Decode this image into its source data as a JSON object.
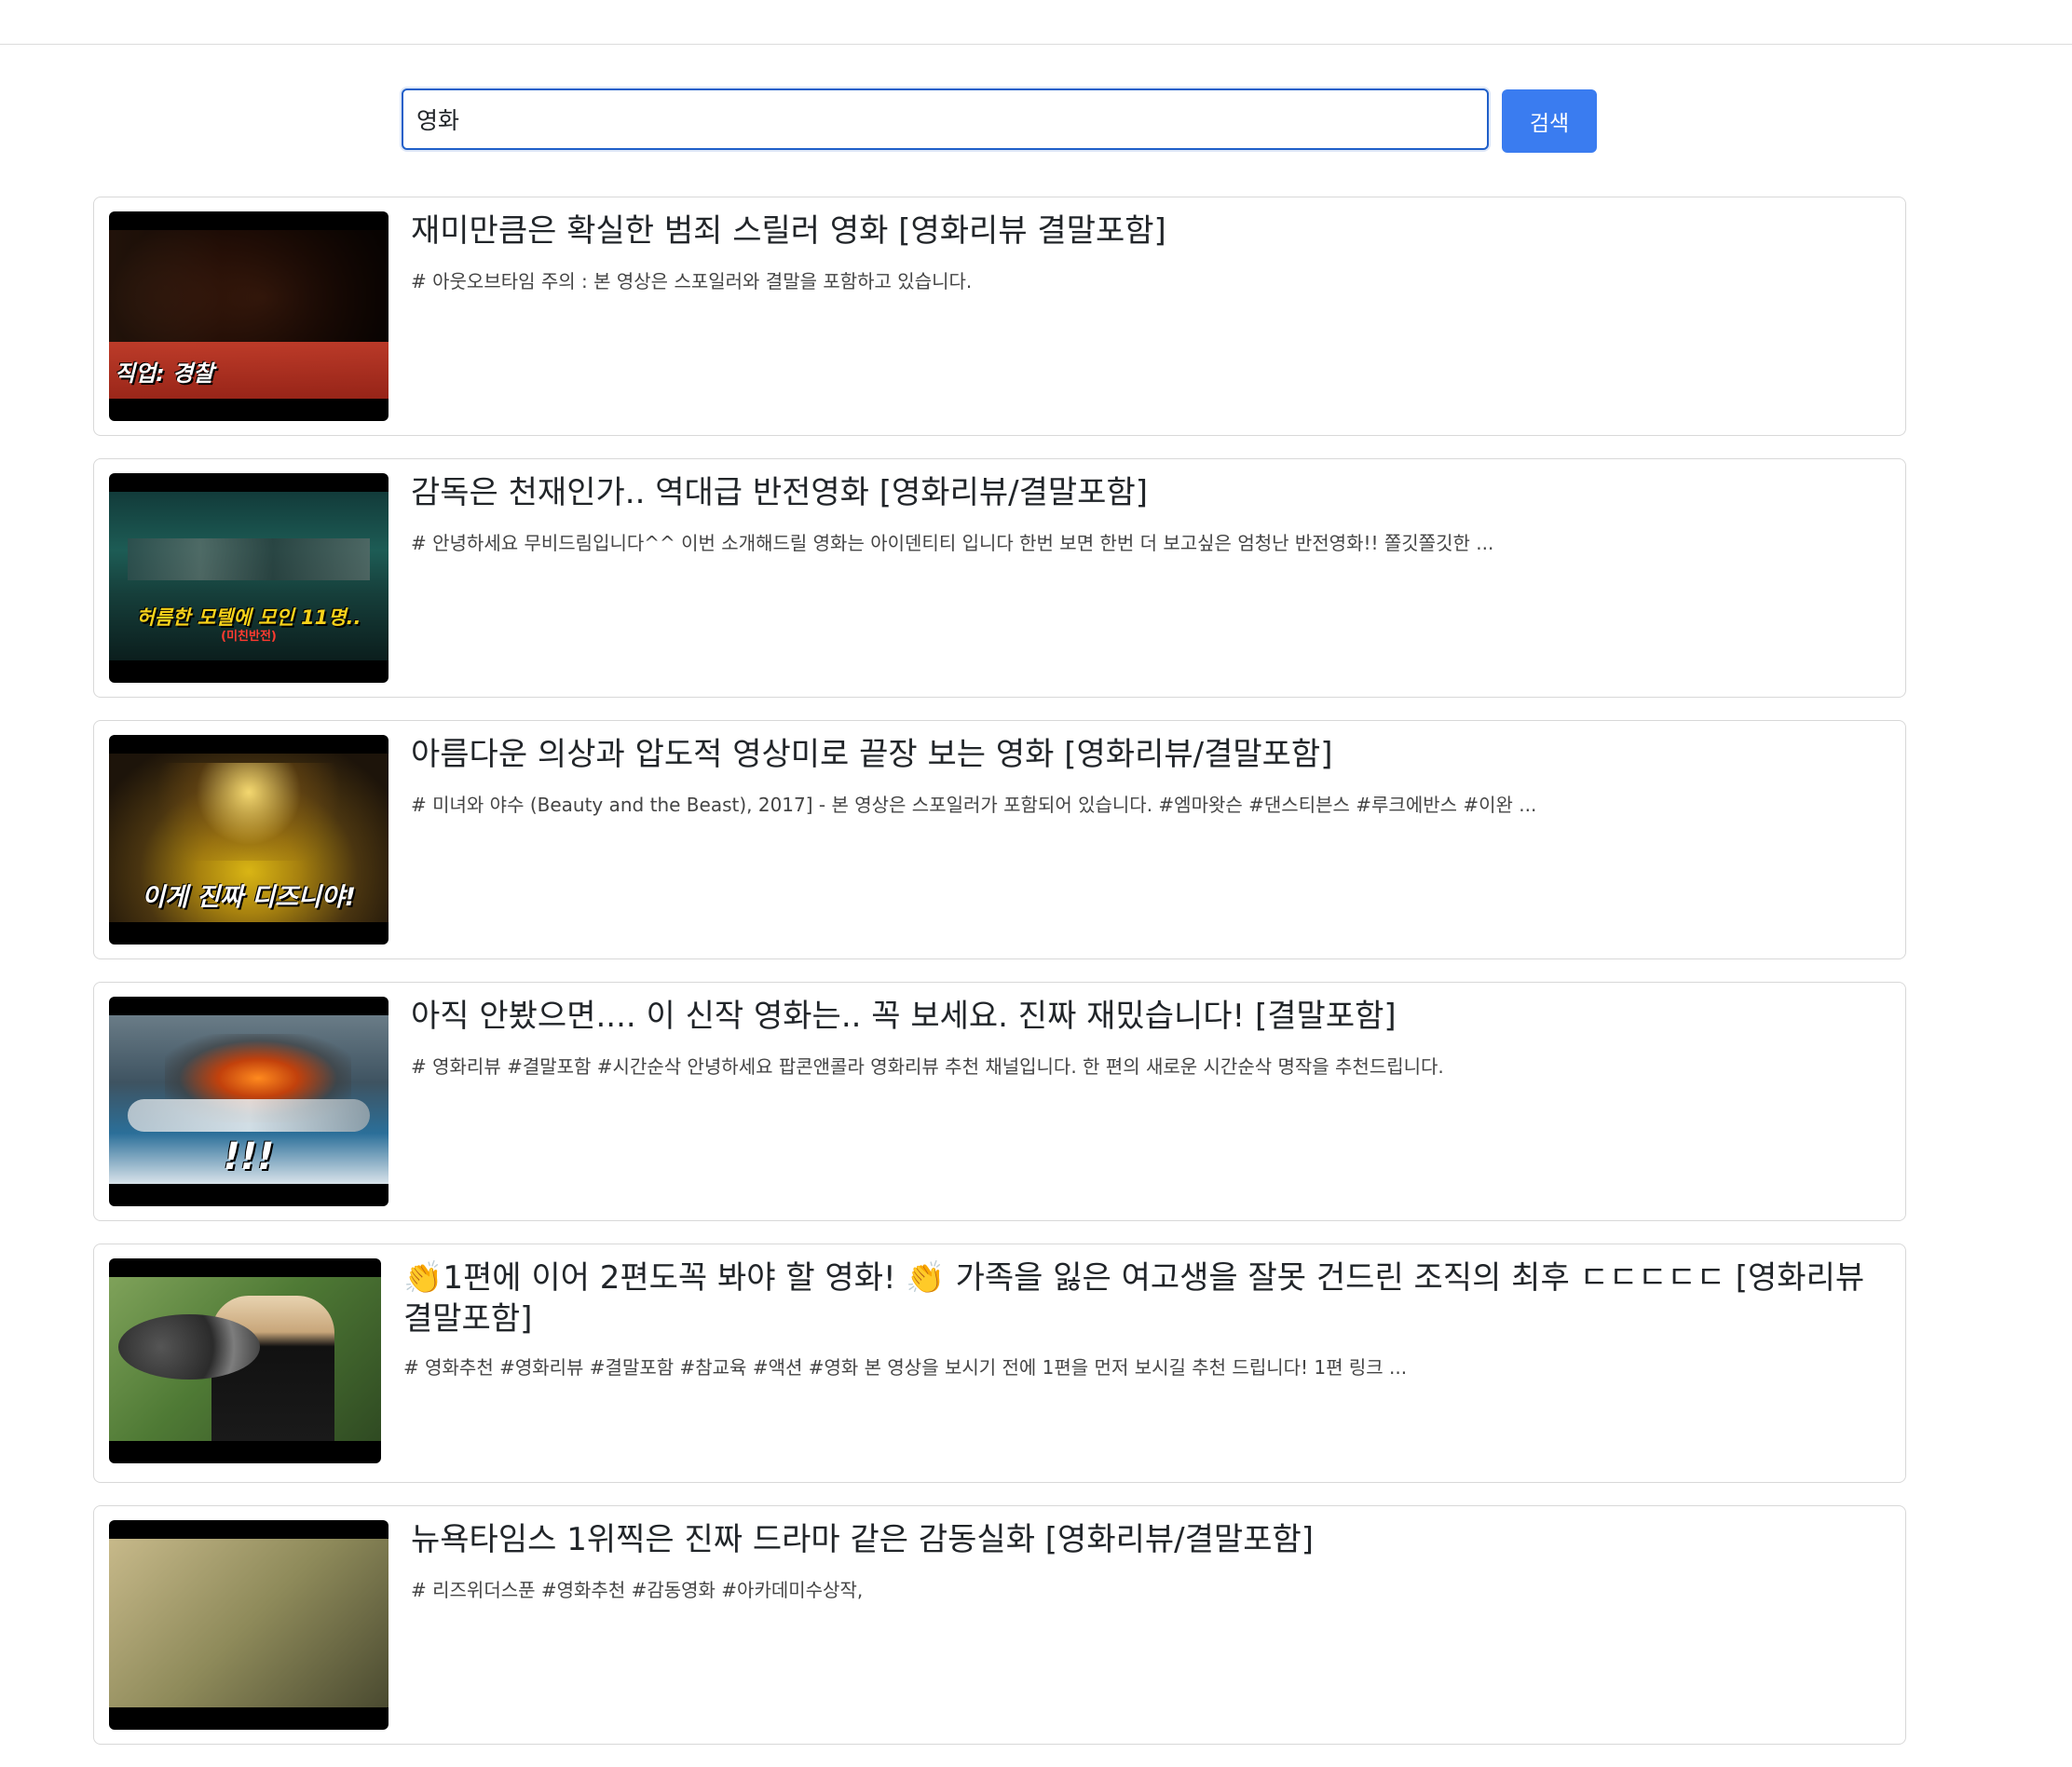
{
  "search": {
    "value": "영화",
    "button_label": "검색"
  },
  "results": [
    {
      "title": "재미만큼은 확실한 범죄 스릴러 영화 [영화리뷰 결말포함]",
      "description": "# 아웃오브타임 주의 : 본 영상은 스포일러와 결말을 포함하고 있습니다.",
      "thumb_caption": "직업: 경찰",
      "thumb_sub": ""
    },
    {
      "title": "감독은 천재인가.. 역대급 반전영화 [영화리뷰/결말포함]",
      "description": "# 안녕하세요 무비드림입니다^^ 이번 소개해드릴 영화는 아이덴티티 입니다 한번 보면 한번 더 보고싶은 엄청난 반전영화!! 쫄깃쫄깃한 ...",
      "thumb_caption": "허름한 모텔에 모인 11명..",
      "thumb_sub": "(미친반전)"
    },
    {
      "title": "아름다운 의상과 압도적 영상미로 끝장 보는 영화 [영화리뷰/결말포함]",
      "description": "# 미녀와 야수 (Beauty and the Beast), 2017] - 본 영상은 스포일러가 포함되어 있습니다. #엠마왓슨 #댄스티븐스 #루크에반스 #이완 ...",
      "thumb_caption": "이게 진짜 디즈니야!",
      "thumb_sub": ""
    },
    {
      "title": "아직 안봤으면.... 이 신작 영화는.. 꼭 보세요. 진짜 재밌습니다! [결말포함]",
      "description": "# 영화리뷰 #결말포함 #시간순삭 안녕하세요 팝콘앤콜라 영화리뷰 추천 채널입니다. 한 편의 새로운 시간순삭 명작을 추천드립니다.",
      "thumb_caption": "!!!",
      "thumb_sub": ""
    },
    {
      "title": "👏1편에 이어 2편도꼭 봐야 할 영화! 👏 가족을 잃은 여고생을 잘못 건드린 조직의 최후 ㄷㄷㄷㄷㄷ [영화리뷰 결말포함]",
      "description": "# 영화추천 #영화리뷰 #결말포함 #참교육 #액션 #영화 본 영상을 보시기 전에 1편을 먼저 보시길 추천 드립니다! 1편 링크 ...",
      "thumb_caption": "",
      "thumb_sub": ""
    },
    {
      "title": "뉴욕타임스 1위찍은 진짜 드라마 같은 감동실화 [영화리뷰/결말포함]",
      "description": "# 리즈위더스푼 #영화추천 #감동영화 #아카데미수상작,",
      "thumb_caption": "",
      "thumb_sub": ""
    }
  ]
}
